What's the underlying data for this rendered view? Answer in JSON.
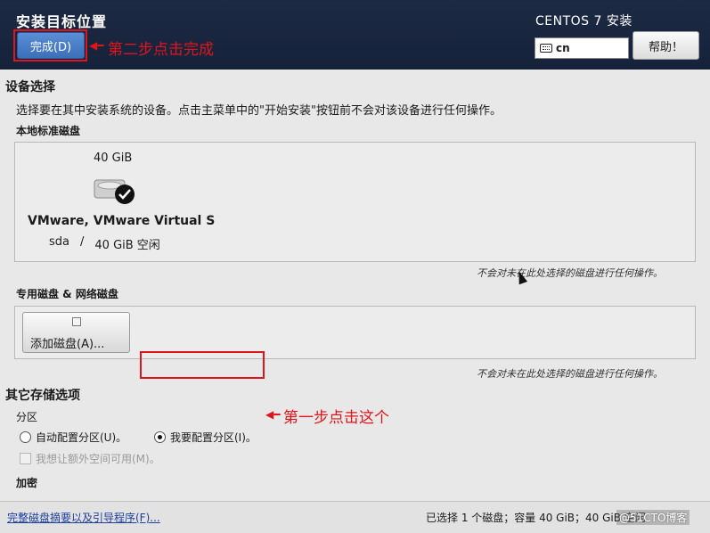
{
  "header": {
    "title": "安装目标位置",
    "done_label": "完成(D)",
    "product": "CENTOS 7 安装",
    "keyboard_layout": "cn",
    "help_label": "帮助！"
  },
  "annotations": {
    "step2": "第二步点击完成",
    "step1": "第一步点击这个"
  },
  "device_selection": {
    "title": "设备选择",
    "description": "选择要在其中安装系统的设备。点击主菜单中的\"开始安装\"按钮前不会对该设备进行任何操作。",
    "local_disks_label": "本地标准磁盘",
    "disk": {
      "size": "40 GiB",
      "name": "VMware, VMware Virtual S",
      "device": "sda",
      "separator": "/",
      "free": "40 GiB 空闲",
      "selected": true
    },
    "local_hint": "不会对未在此处选择的磁盘进行任何操作。",
    "special_disks_label": "专用磁盘 & 网络磁盘",
    "add_disk_label": "添加磁盘(A)...",
    "special_hint": "不会对未在此处选择的磁盘进行任何操作。"
  },
  "other_storage": {
    "title": "其它存储选项",
    "partition_label": "分区",
    "auto_partition_label": "自动配置分区(U)。",
    "manual_partition_label": "我要配置分区(I)。",
    "selected_option": "manual",
    "extra_space_label": "我想让额外空间可用(M)。",
    "encryption_label": "加密"
  },
  "footer": {
    "summary_link": "完整磁盘摘要以及引导程序(F)...",
    "status": "已选择 1 个磁盘；容量 40 GiB；40 GiB 空闲",
    "watermark": "@51CTO博客"
  },
  "colors": {
    "header_bg": "#1d2a44",
    "done_button": "#4a7fc6",
    "annotation": "#e0151b",
    "link": "#1d3f9e"
  }
}
